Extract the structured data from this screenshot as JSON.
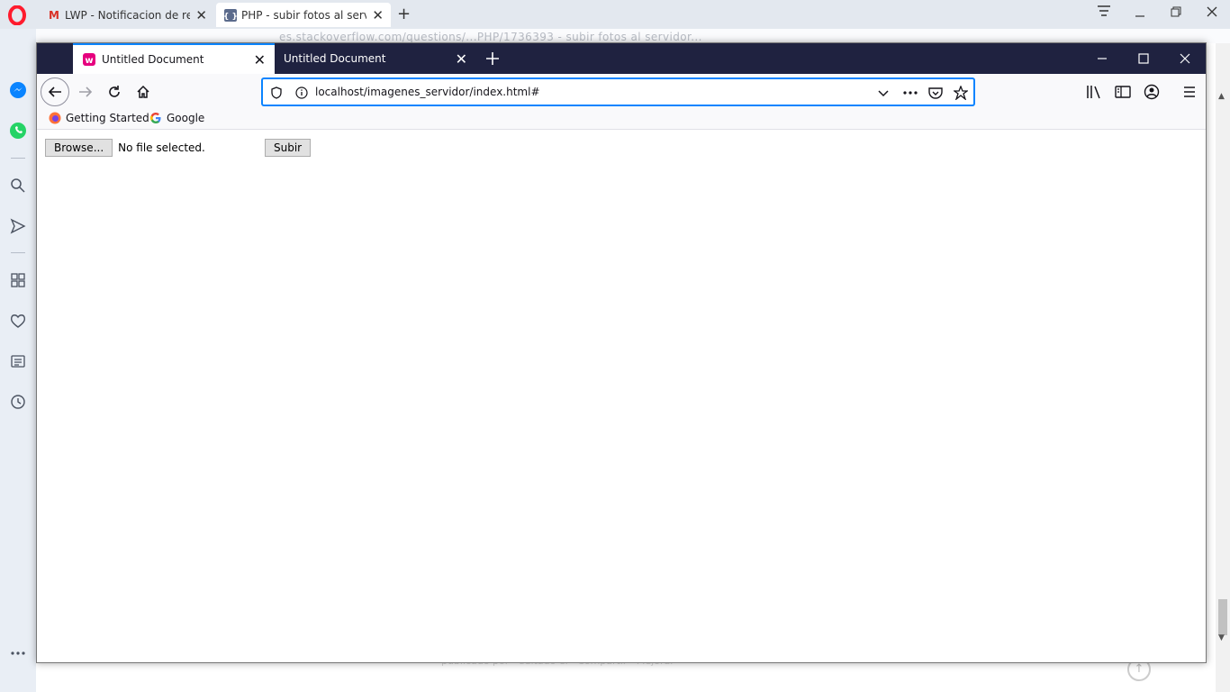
{
  "opera": {
    "tabs": [
      {
        "title": "LWP - Notificacion de respu",
        "favicon": "gmail-icon"
      },
      {
        "title": "PHP - subir fotos al servidor",
        "favicon": "php-icon"
      }
    ],
    "new_tab_label": "+",
    "faint_address": "es.stackoverflow.com/questions/...PHP/1736393 - subir fotos al servidor...",
    "bottom_faint_text": "publicado por · editado el · Compartir · Mejorar"
  },
  "firefox": {
    "tabs": [
      {
        "title": "Untitled Document",
        "favicon": "wamp-icon",
        "active": true
      },
      {
        "title": "Untitled Document",
        "favicon": "none",
        "active": false
      }
    ],
    "url": "localhost/imagenes_servidor/index.html#",
    "bookmarks": [
      {
        "label": "Getting Started",
        "icon": "firefox-icon"
      },
      {
        "label": "Google",
        "icon": "google-icon"
      }
    ]
  },
  "page": {
    "browse_button": "Browse...",
    "file_status": "No file selected.",
    "submit_button": "Subir"
  },
  "colors": {
    "firefox_titlebar": "#1f2240",
    "firefox_accent": "#0a84ff",
    "opera_red": "#ff1b2d"
  }
}
